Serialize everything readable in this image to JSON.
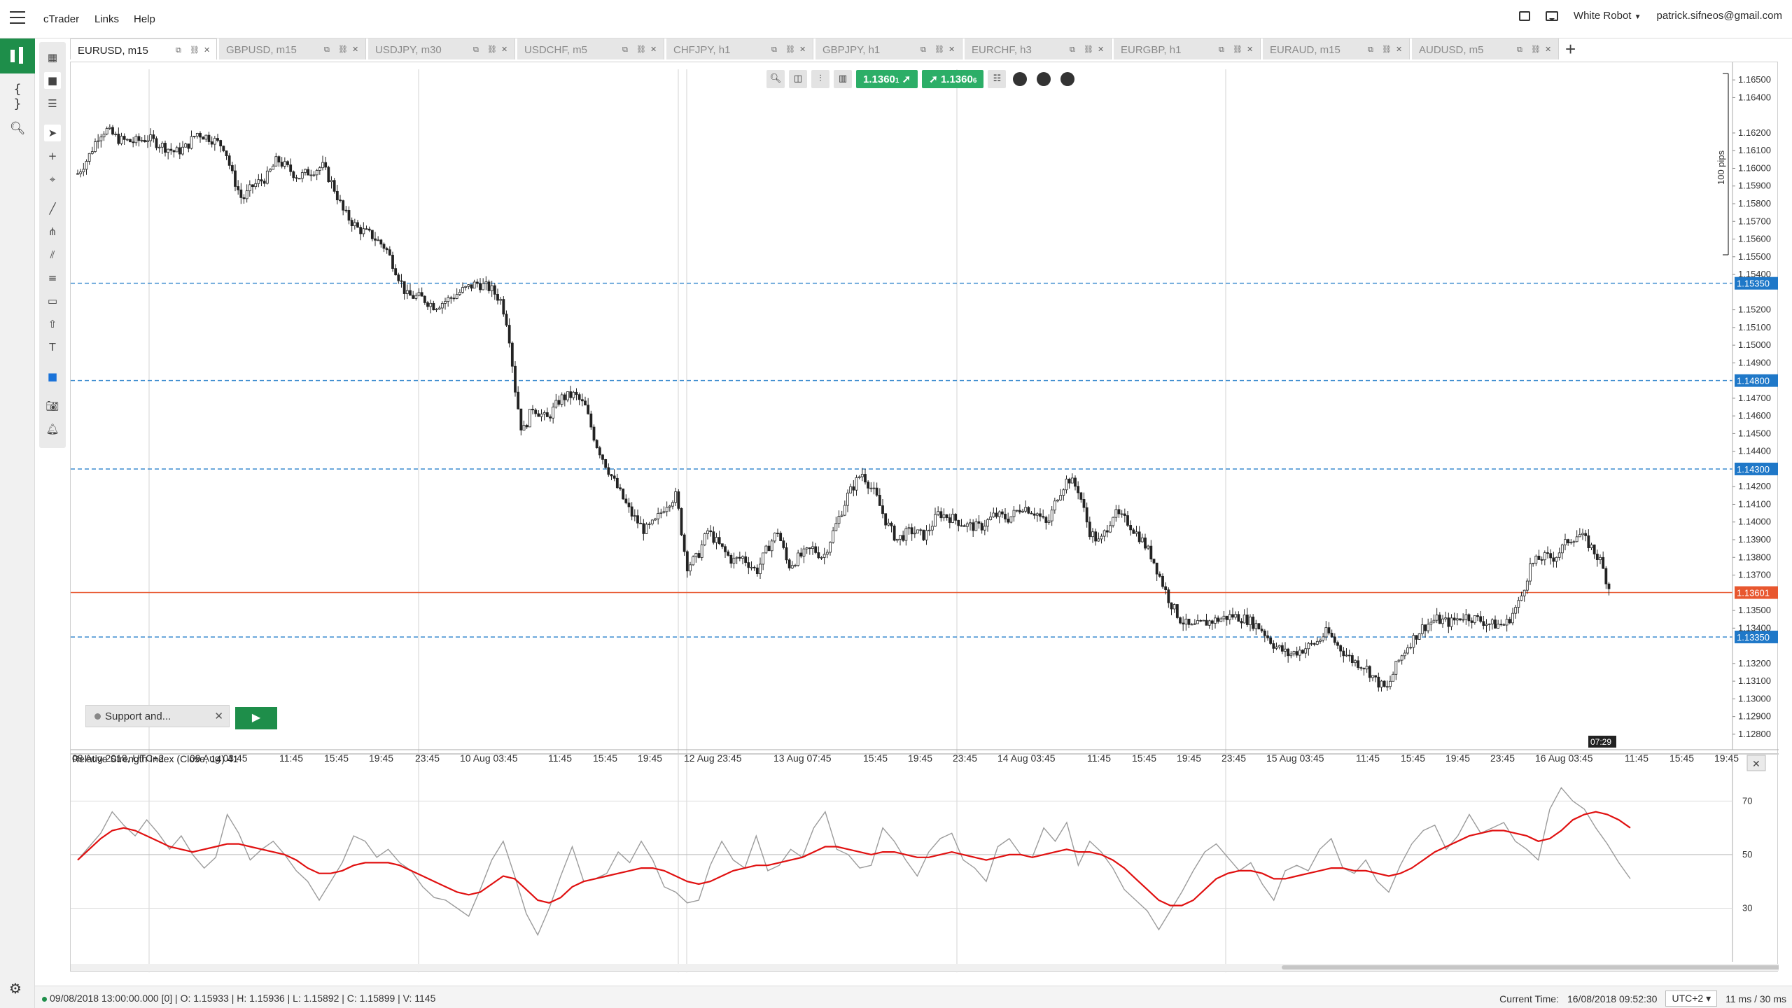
{
  "app": {
    "menu": [
      "cTrader",
      "Links",
      "Help"
    ],
    "robot_label": "White Robot",
    "user_email": "patrick.sifneos@gmail.com"
  },
  "tabs": [
    {
      "label": "EURUSD, m15",
      "active": true
    },
    {
      "label": "GBPUSD, m15",
      "active": false
    },
    {
      "label": "USDJPY, m30",
      "active": false
    },
    {
      "label": "USDCHF, m5",
      "active": false
    },
    {
      "label": "CHFJPY, h1",
      "active": false
    },
    {
      "label": "GBPJPY, h1",
      "active": false
    },
    {
      "label": "EURCHF, h3",
      "active": false
    },
    {
      "label": "EURGBP, h1",
      "active": false
    },
    {
      "label": "EURAUD, m15",
      "active": false
    },
    {
      "label": "AUDUSD, m5",
      "active": false
    }
  ],
  "quick_trade": {
    "sell_price": "1.1360",
    "sell_sup": "1",
    "buy_price": "1.1360",
    "buy_sup": "6"
  },
  "colors": {
    "buy": "#2cae67",
    "level_line": "#3c8ccf",
    "price_line": "#e8572f",
    "rsi_ma": "#e01010",
    "rsi_line": "#9b9b9b"
  },
  "support_panel": {
    "label": "Support and..."
  },
  "status": {
    "ohlc": "09/08/2018 13:00:00.000 [0] | O: 1.15933 | H: 1.15936 | L: 1.15892 | C: 1.15899 | V: 1145",
    "current_time_label": "Current Time:",
    "current_time": "16/08/2018 09:52:30",
    "timezone": "UTC+2",
    "latency": "11 ms / 30 ms"
  },
  "chart_data": [
    {
      "type": "candlestick",
      "symbol": "EURUSD",
      "timeframe": "m15",
      "price_axis": {
        "ylim": [
          1.1276,
          1.1656
        ],
        "ticks": [
          "1.16500",
          "1.16400",
          "1.16200",
          "1.16100",
          "1.16000",
          "1.15900",
          "1.15800",
          "1.15700",
          "1.15600",
          "1.15500",
          "1.15400",
          "1.15200",
          "1.15100",
          "1.15000",
          "1.14900",
          "1.14700",
          "1.14600",
          "1.14500",
          "1.14400",
          "1.14200",
          "1.14100",
          "1.14000",
          "1.13900",
          "1.13800",
          "1.13700",
          "1.13500",
          "1.13400",
          "1.13200",
          "1.13100",
          "1.13000",
          "1.12900",
          "1.12800"
        ],
        "tick_values": [
          1.165,
          1.164,
          1.162,
          1.161,
          1.16,
          1.159,
          1.158,
          1.157,
          1.156,
          1.155,
          1.154,
          1.152,
          1.151,
          1.15,
          1.149,
          1.147,
          1.146,
          1.145,
          1.144,
          1.142,
          1.141,
          1.14,
          1.139,
          1.138,
          1.137,
          1.135,
          1.134,
          1.132,
          1.131,
          1.13,
          1.129,
          1.128
        ]
      },
      "time_axis": [
        "08 Aug 2018, UTC+2",
        "09 Aug 03:45",
        "11:45",
        "15:45",
        "19:45",
        "23:45",
        "10 Aug 03:45",
        "11:45",
        "15:45",
        "19:45",
        "12 Aug 23:45",
        "13 Aug 07:45",
        "15:45",
        "19:45",
        "23:45",
        "14 Aug 03:45",
        "11:45",
        "15:45",
        "19:45",
        "23:45",
        "15 Aug 03:45",
        "11:45",
        "15:45",
        "19:45",
        "23:45",
        "16 Aug 03:45",
        "11:45",
        "15:45",
        "19:45"
      ],
      "price_levels": [
        {
          "label": "1.15350",
          "value": 1.1535
        },
        {
          "label": "1.14800",
          "value": 1.148
        },
        {
          "label": "1.14300",
          "value": 1.143
        },
        {
          "label": "1.13350",
          "value": 1.1335
        }
      ],
      "current_price": {
        "label": "1.13601",
        "value": 1.13601
      },
      "countdown": "07:29",
      "range_label": "100 pips",
      "close_path": [
        [
          0,
          1.1597
        ],
        [
          1.5,
          1.1606
        ],
        [
          3,
          1.1619
        ],
        [
          4,
          1.1622
        ],
        [
          6,
          1.1616
        ],
        [
          8,
          1.1615
        ],
        [
          10,
          1.1617
        ],
        [
          12,
          1.1613
        ],
        [
          14,
          1.1609
        ],
        [
          15.5,
          1.1612
        ],
        [
          17,
          1.162
        ],
        [
          19,
          1.1617
        ],
        [
          21,
          1.1612
        ],
        [
          22,
          1.1597
        ],
        [
          23.5,
          1.1582
        ],
        [
          25,
          1.159
        ],
        [
          27,
          1.1595
        ],
        [
          28.5,
          1.1605
        ],
        [
          30,
          1.16
        ],
        [
          31.5,
          1.1595
        ],
        [
          33,
          1.1598
        ],
        [
          35,
          1.1601
        ],
        [
          36.5,
          1.159
        ],
        [
          38,
          1.1575
        ],
        [
          40,
          1.1566
        ],
        [
          42,
          1.1562
        ],
        [
          44,
          1.1555
        ],
        [
          45.5,
          1.1542
        ],
        [
          47,
          1.1528
        ],
        [
          49,
          1.1527
        ],
        [
          51,
          1.1522
        ],
        [
          53,
          1.1526
        ],
        [
          55,
          1.1531
        ],
        [
          57,
          1.1535
        ],
        [
          59,
          1.1532
        ],
        [
          60.5,
          1.1525
        ],
        [
          61.5,
          1.151
        ],
        [
          62.5,
          1.1475
        ],
        [
          63.5,
          1.145
        ],
        [
          65,
          1.1465
        ],
        [
          67,
          1.1458
        ],
        [
          69,
          1.147
        ],
        [
          71,
          1.1472
        ],
        [
          72.5,
          1.1465
        ],
        [
          74,
          1.1445
        ],
        [
          75.5,
          1.1432
        ],
        [
          77,
          1.142
        ],
        [
          79,
          1.1405
        ],
        [
          81,
          1.1395
        ],
        [
          82.5,
          1.14
        ],
        [
          84,
          1.141
        ],
        [
          85.5,
          1.1415
        ],
        [
          87,
          1.1375
        ],
        [
          88.5,
          1.138
        ],
        [
          90,
          1.1395
        ],
        [
          92,
          1.1385
        ],
        [
          93.5,
          1.1378
        ],
        [
          95,
          1.138
        ],
        [
          97,
          1.1372
        ],
        [
          98.5,
          1.1385
        ],
        [
          100,
          1.1395
        ],
        [
          101.5,
          1.1375
        ],
        [
          103,
          1.138
        ],
        [
          105,
          1.1385
        ],
        [
          106.5,
          1.138
        ],
        [
          108,
          1.1395
        ],
        [
          110,
          1.1415
        ],
        [
          112,
          1.1428
        ],
        [
          114,
          1.1415
        ],
        [
          115.5,
          1.14
        ],
        [
          117,
          1.139
        ],
        [
          119,
          1.1395
        ],
        [
          121,
          1.1392
        ],
        [
          123,
          1.1405
        ],
        [
          125,
          1.1402
        ],
        [
          127,
          1.1398
        ],
        [
          129,
          1.1397
        ],
        [
          131,
          1.1404
        ],
        [
          133,
          1.1402
        ],
        [
          135,
          1.1409
        ],
        [
          137,
          1.1405
        ],
        [
          138.5,
          1.1398
        ],
        [
          140,
          1.1415
        ],
        [
          141.5,
          1.1425
        ],
        [
          143,
          1.1418
        ],
        [
          144.5,
          1.1395
        ],
        [
          146,
          1.1388
        ],
        [
          148,
          1.1405
        ],
        [
          150,
          1.14
        ],
        [
          152,
          1.139
        ],
        [
          153.5,
          1.138
        ],
        [
          155,
          1.1365
        ],
        [
          156,
          1.1355
        ],
        [
          157.5,
          1.1345
        ],
        [
          159,
          1.134
        ],
        [
          161,
          1.1343
        ],
        [
          163,
          1.1345
        ],
        [
          165,
          1.1347
        ],
        [
          167,
          1.1345
        ],
        [
          169,
          1.134
        ],
        [
          171,
          1.133
        ],
        [
          173,
          1.1325
        ],
        [
          175,
          1.1328
        ],
        [
          177,
          1.1332
        ],
        [
          178.5,
          1.1338
        ],
        [
          180,
          1.133
        ],
        [
          182,
          1.1322
        ],
        [
          184,
          1.1318
        ],
        [
          185.5,
          1.131
        ],
        [
          187,
          1.1305
        ],
        [
          188.5,
          1.132
        ],
        [
          190,
          1.133
        ],
        [
          192,
          1.134
        ],
        [
          194,
          1.1345
        ],
        [
          196,
          1.1343
        ],
        [
          198,
          1.1347
        ],
        [
          200,
          1.1345
        ],
        [
          202,
          1.1342
        ],
        [
          204,
          1.1342
        ],
        [
          206,
          1.1355
        ],
        [
          207.5,
          1.1375
        ],
        [
          209,
          1.138
        ],
        [
          211,
          1.138
        ],
        [
          213,
          1.139
        ],
        [
          214.5,
          1.1393
        ],
        [
          216,
          1.1387
        ],
        [
          217.5,
          1.1378
        ],
        [
          218.5,
          1.1366
        ],
        [
          219,
          1.136
        ]
      ]
    },
    {
      "type": "line",
      "title": "Relative Strength Index (Close, 14) 41",
      "ylim": [
        10,
        85
      ],
      "ticks": [
        70,
        50,
        30
      ],
      "series": [
        {
          "color": "#9b9b9b",
          "values": [
            48,
            53,
            58,
            66,
            61,
            57,
            63,
            58,
            52,
            57,
            50,
            45,
            49,
            65,
            58,
            48,
            52,
            55,
            50,
            44,
            40,
            33,
            40,
            47,
            57,
            55,
            49,
            52,
            47,
            44,
            38,
            34,
            33,
            30,
            27,
            37,
            48,
            55,
            42,
            28,
            20,
            30,
            42,
            53,
            40,
            41,
            43,
            51,
            47,
            55,
            48,
            38,
            36,
            32,
            33,
            46,
            55,
            48,
            45,
            57,
            44,
            46,
            52,
            49,
            60,
            66,
            52,
            50,
            45,
            46,
            60,
            55,
            48,
            42,
            51,
            56,
            58,
            48,
            45,
            40,
            53,
            56,
            50,
            49,
            60,
            55,
            62,
            46,
            55,
            51,
            45,
            37,
            33,
            29,
            22,
            29,
            36,
            44,
            51,
            54,
            49,
            44,
            47,
            39,
            33,
            44,
            46,
            44,
            52,
            56,
            45,
            43,
            48,
            40,
            36,
            46,
            54,
            59,
            61,
            52,
            57,
            65,
            58,
            60,
            62,
            55,
            52,
            48,
            67,
            75,
            70,
            67,
            60,
            54,
            47,
            41
          ]
        },
        {
          "color": "#e01010",
          "values": [
            48,
            52,
            56,
            59,
            60,
            59,
            57,
            55,
            53,
            52,
            51,
            52,
            53,
            54,
            54,
            53,
            52,
            51,
            50,
            48,
            45,
            43,
            43,
            44,
            46,
            47,
            47,
            47,
            46,
            44,
            42,
            40,
            38,
            36,
            35,
            36,
            39,
            42,
            41,
            37,
            33,
            32,
            34,
            38,
            40,
            41,
            42,
            43,
            44,
            45,
            45,
            44,
            42,
            40,
            39,
            40,
            42,
            44,
            45,
            46,
            46,
            47,
            48,
            49,
            51,
            53,
            53,
            52,
            51,
            50,
            51,
            51,
            50,
            49,
            49,
            50,
            51,
            50,
            49,
            48,
            49,
            50,
            50,
            49,
            50,
            51,
            52,
            51,
            51,
            50,
            48,
            45,
            41,
            37,
            33,
            31,
            31,
            33,
            37,
            41,
            43,
            44,
            44,
            43,
            41,
            41,
            42,
            43,
            44,
            45,
            45,
            44,
            44,
            43,
            42,
            43,
            45,
            48,
            51,
            53,
            55,
            57,
            58,
            59,
            59,
            58,
            57,
            55,
            56,
            59,
            63,
            65,
            66,
            65,
            63,
            60
          ]
        }
      ]
    }
  ]
}
